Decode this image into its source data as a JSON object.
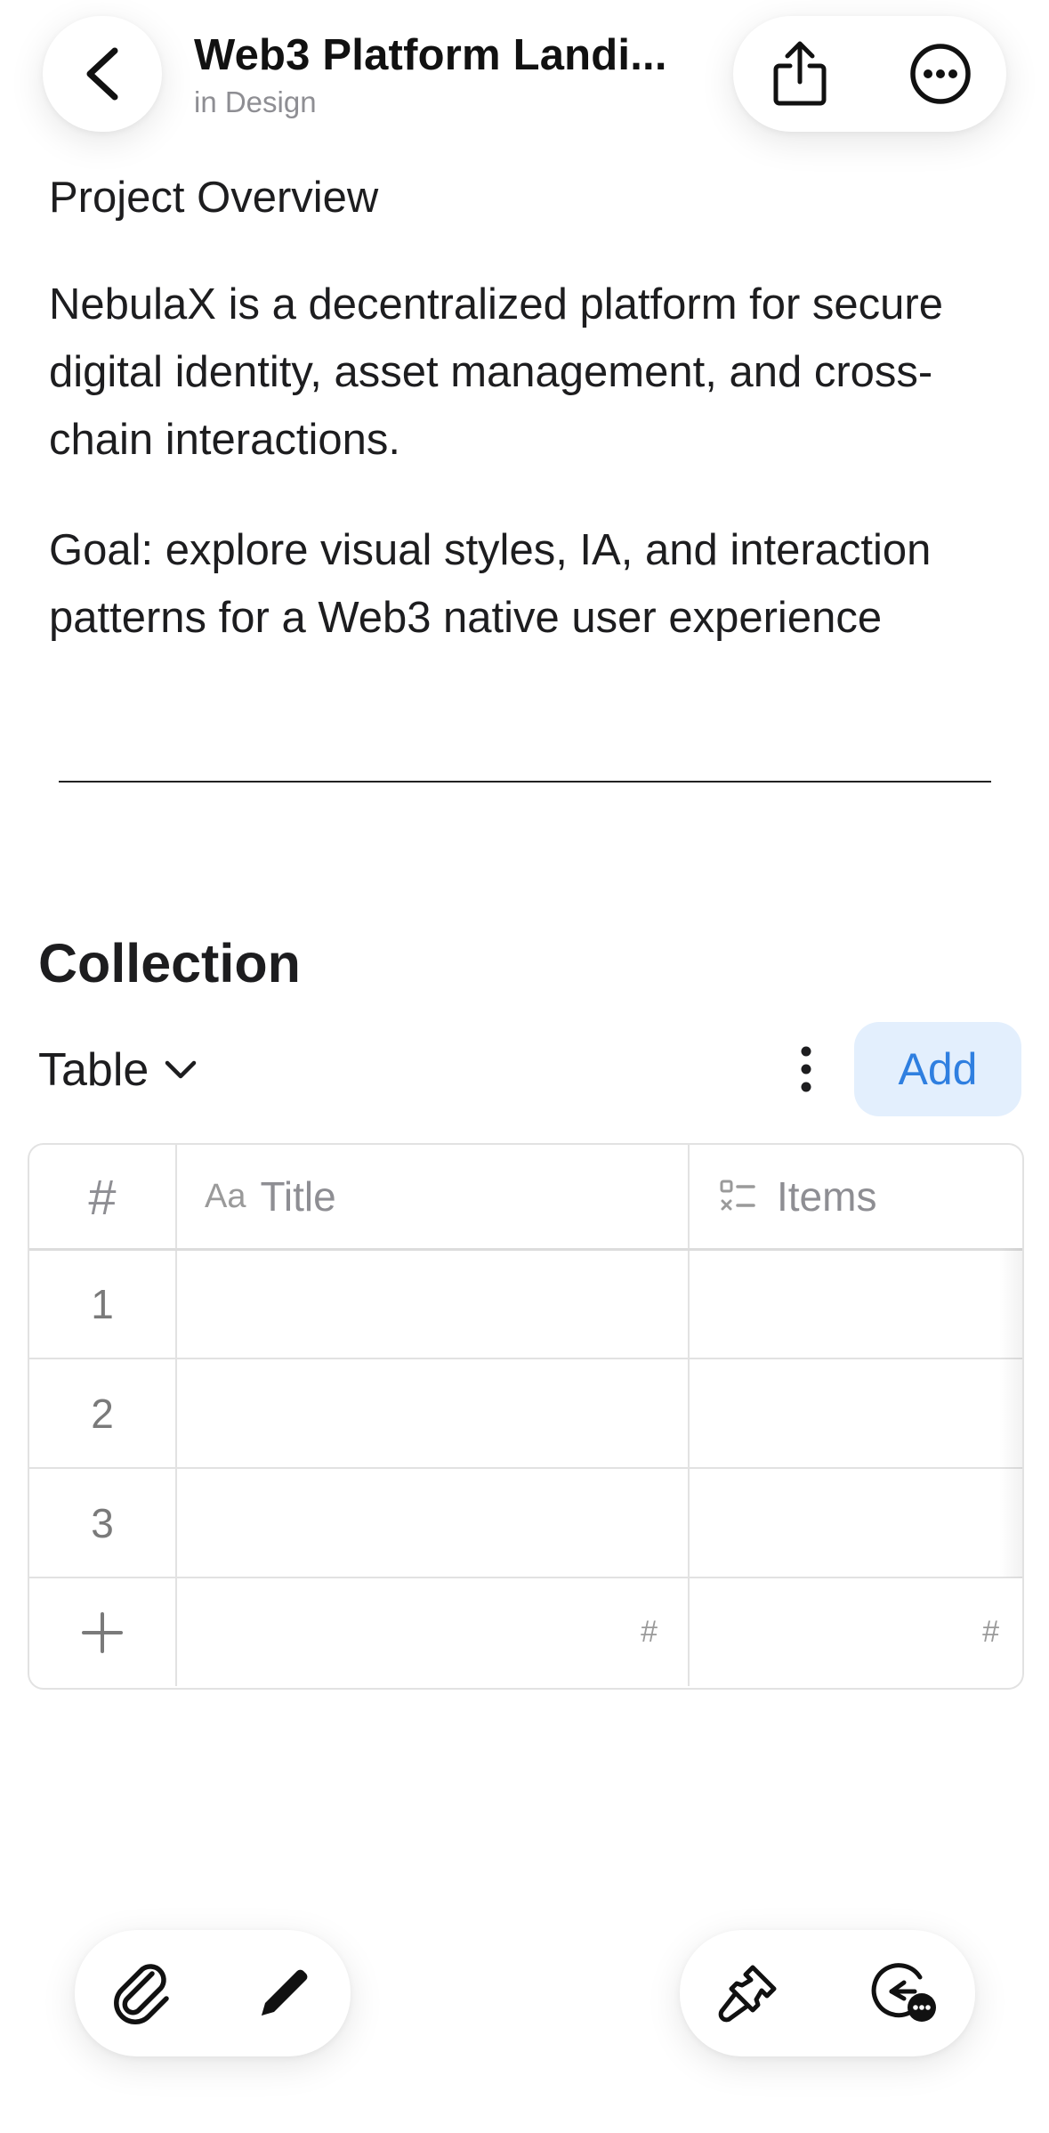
{
  "header": {
    "title": "Web3 Platform Landi...",
    "subtitle": "in Design",
    "icons": {
      "back": "chevron-left-icon",
      "share": "share-icon",
      "more": "ellipsis-circle-icon"
    }
  },
  "content": {
    "heading": "Project Overview",
    "paragraph1": "NebulaX is a decentralized platform for secure digital identity, asset management, and cross-chain interactions.",
    "paragraph2": "Goal: explore visual styles, IA, and interaction patterns for a Web3 native user experience"
  },
  "collection": {
    "heading": "Collection",
    "view_label": "Table",
    "add_label": "Add",
    "table": {
      "columns": [
        {
          "icon": "hash-icon",
          "label": "#"
        },
        {
          "icon": "text-aa-icon",
          "icon_text": "Aa",
          "label": "Title"
        },
        {
          "icon": "checklist-icon",
          "label": "Items"
        }
      ],
      "rows": [
        {
          "index": "1",
          "title": "",
          "items": ""
        },
        {
          "index": "2",
          "title": "",
          "items": ""
        },
        {
          "index": "3",
          "title": "",
          "items": ""
        }
      ],
      "footer": {
        "add_icon": "plus-icon",
        "title_summary": "#",
        "items_summary": "#"
      }
    }
  },
  "toolbar": {
    "left": [
      "paperclip-icon",
      "pencil-icon"
    ],
    "right": [
      "paintbrush-icon",
      "history-chat-icon"
    ]
  },
  "colors": {
    "accent": "#2f7fe0",
    "accent_bg": "#e3effd",
    "text": "#1d1d1f",
    "muted": "#8e8e93",
    "border": "#e2e2e2"
  }
}
